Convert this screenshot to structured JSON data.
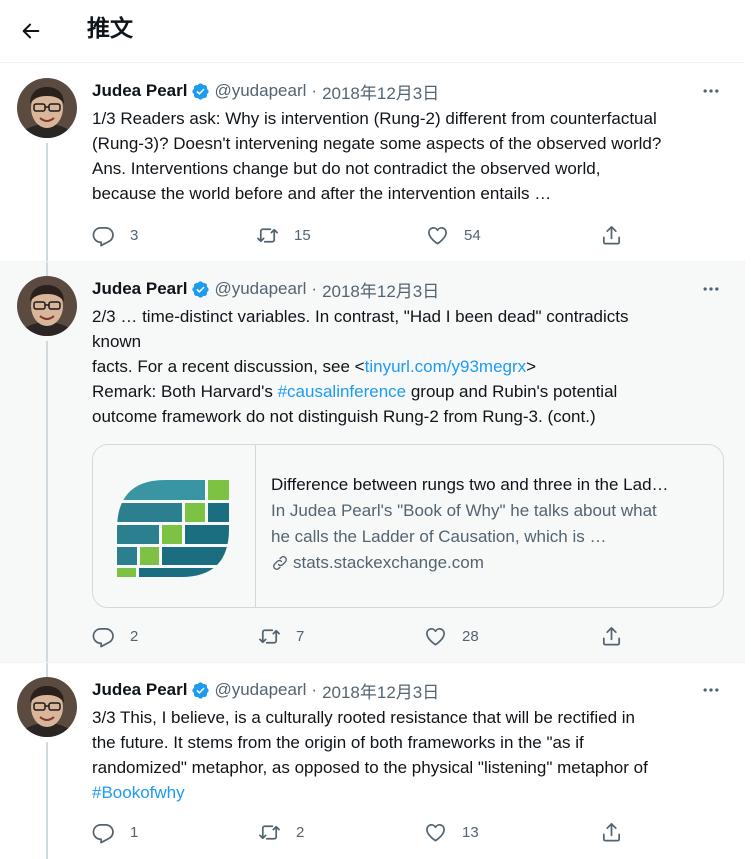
{
  "header": {
    "title": "推文"
  },
  "tweets": [
    {
      "name": "Judea Pearl",
      "handle": "@yudapearl",
      "dot": "·",
      "date": "2018年12月3日",
      "lines": [
        "1/3 Readers ask: Why is intervention (Rung-2) different from counterfactual",
        "(Rung-3)? Doesn't intervening negate some aspects of the observed world?",
        "Ans. Interventions change but do not contradict the observed world,",
        "because the world before and after the intervention entails …"
      ],
      "replies": "3",
      "retweets": "15",
      "likes": "54"
    },
    {
      "name": "Judea Pearl",
      "handle": "@yudapearl",
      "dot": "·",
      "date": "2018年12月3日",
      "line1": "2/3 … time-distinct variables. In contrast, \"Had I been dead\" contradicts",
      "line2": "known",
      "line3_pre": "facts. For a recent discussion, see <",
      "line3_link": "tinyurl.com/y93megrx",
      "line3_post": ">",
      "line4_pre": "Remark: Both Harvard's ",
      "line4_link": "#causalinference",
      "line4_post": " group and Rubin's potential",
      "line5": "outcome framework do not distinguish Rung-2 from Rung-3. (cont.)",
      "card": {
        "title": "Difference between rungs two and three in the Lad…",
        "desc1": "In Judea Pearl's \"Book of Why\" he talks about what",
        "desc2": "he calls the Ladder of Causation, which is …",
        "domain": "stats.stackexchange.com"
      },
      "replies": "2",
      "retweets": "7",
      "likes": "28"
    },
    {
      "name": "Judea Pearl",
      "handle": "@yudapearl",
      "dot": "·",
      "date": "2018年12月3日",
      "lines": [
        "3/3 This, I believe, is a culturally rooted resistance that will be rectified in",
        "the future. It stems from the origin of both frameworks in the \"as if",
        "randomized\" metaphor, as opposed to the physical \"listening\" metaphor of"
      ],
      "hashtag": "#Bookofwhy",
      "replies": "1",
      "retweets": "2",
      "likes": "13"
    }
  ],
  "icons": {
    "back": "arrow-left-icon",
    "verified": "verified-badge-icon",
    "more": "more-dots-icon",
    "reply": "reply-icon",
    "retweet": "retweet-icon",
    "like": "heart-icon",
    "share": "share-icon",
    "link": "link-icon"
  },
  "colors": {
    "accent": "#1d9bf0",
    "text": "#0f1419",
    "muted": "#536471",
    "highlight_bg": "#f7f9f9"
  }
}
